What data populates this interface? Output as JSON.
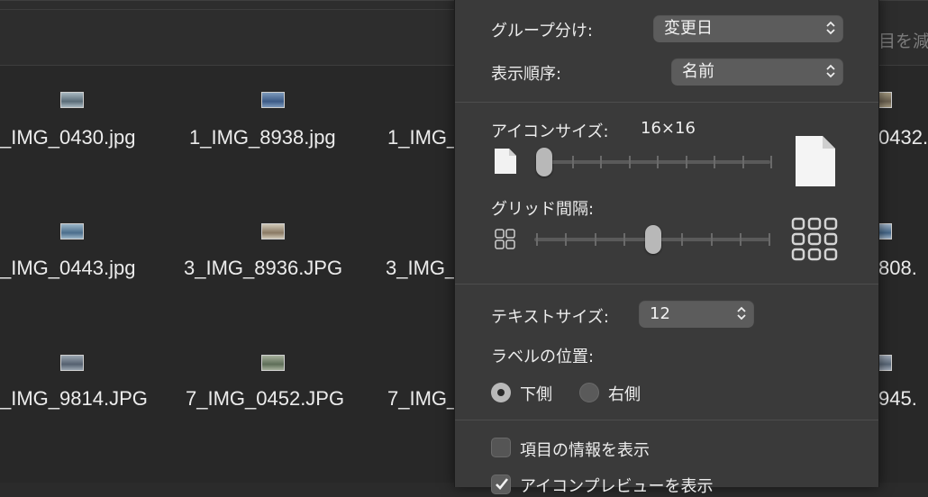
{
  "toolbar": {
    "truncated_text": "目を減"
  },
  "files": [
    {
      "name": "_IMG_0430.jpg",
      "thumb": [
        "#5a6c78",
        "#a8b8c0"
      ]
    },
    {
      "name": "1_IMG_8938.jpg",
      "thumb": [
        "#3c5a86",
        "#7d9abc"
      ]
    },
    {
      "name": "1_IMG_",
      "thumb": null
    },
    {
      "name": "0432.",
      "thumb": [
        "#6a6050",
        "#a49980"
      ]
    },
    {
      "name": "_IMG_0443.jpg",
      "thumb": [
        "#4b6e8c",
        "#9cb6c8"
      ]
    },
    {
      "name": "3_IMG_8936.JPG",
      "thumb": [
        "#8a7a64",
        "#d0c8b8"
      ]
    },
    {
      "name": "3_IMG_",
      "thumb": null
    },
    {
      "name": "808.",
      "thumb": [
        "#446688",
        "#a0b4c8"
      ]
    },
    {
      "name": "_IMG_9814.JPG",
      "thumb": [
        "#556070",
        "#9aa6b0"
      ]
    },
    {
      "name": "7_IMG_0452.JPG",
      "thumb": [
        "#5e6e58",
        "#a6b09c"
      ]
    },
    {
      "name": "7_IMG_",
      "thumb": null
    },
    {
      "name": "945.",
      "thumb": [
        "#5a6878",
        "#a0aab8"
      ]
    }
  ],
  "view_options": {
    "group_by": {
      "label": "グループ分け:",
      "value": "変更日"
    },
    "sort_by": {
      "label": "表示順序:",
      "value": "名前"
    },
    "icon_size": {
      "label": "アイコンサイズ:",
      "value": "16×16",
      "slider_level": 0.0
    },
    "grid_spacing": {
      "label": "グリッド間隔:",
      "slider_level": 0.5
    },
    "text_size": {
      "label": "テキストサイズ:",
      "value": "12"
    },
    "label_position": {
      "label": "ラベルの位置:",
      "options": [
        {
          "label": "下側",
          "selected": true
        },
        {
          "label": "右側",
          "selected": false
        }
      ]
    },
    "show_item_info": {
      "label": "項目の情報を表示",
      "checked": false
    },
    "show_icon_preview": {
      "label": "アイコンプレビューを表示",
      "checked": true
    }
  }
}
